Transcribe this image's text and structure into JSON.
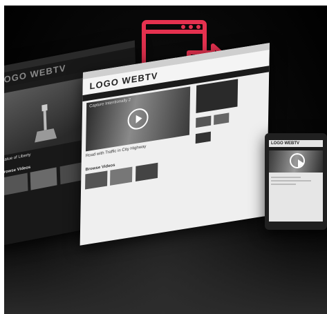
{
  "colors": {
    "accent": "#e5314f",
    "background": "#000000"
  },
  "icons": {
    "browser_export": "window-with-arrow-icon"
  },
  "left_screen": {
    "logo": "LOGO WEBTV",
    "video_title": "Statue of Liberty",
    "section_title": "Browse Videos"
  },
  "main_screen": {
    "logo": "LOGO WEBTV",
    "video_title": "Capture Intentionally 2",
    "caption": "Road with Traffic in City Highway",
    "section_title": "Browse Videos"
  },
  "tablet_screen": {
    "logo": "LOGO WEBTV"
  }
}
